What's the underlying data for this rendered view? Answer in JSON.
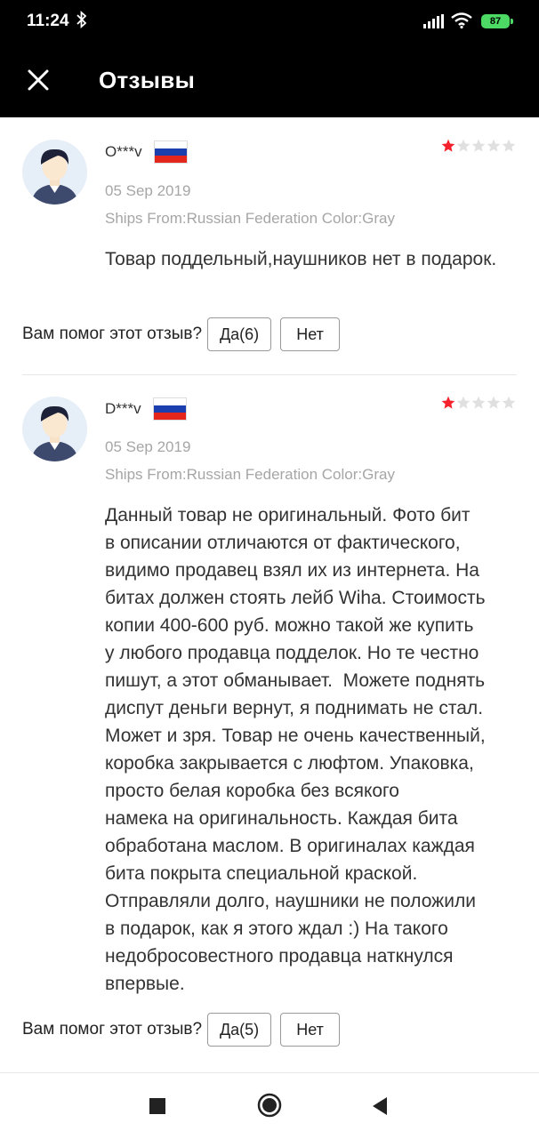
{
  "status_bar": {
    "time": "11:24",
    "battery": "87"
  },
  "header": {
    "title": "Отзывы"
  },
  "colors": {
    "star_active": "#f5222d",
    "star_inactive": "#e0e0e0",
    "muted_text": "#a6a6a6"
  },
  "reviews": [
    {
      "name": "O***v",
      "country": "Russia",
      "rating": 1,
      "max_rating": 5,
      "date": "05 Sep 2019",
      "meta": "Ships From:Russian Federation Color:Gray",
      "text": "Товар поддельный,наушников нет в подарок.",
      "helpful_question": "Вам помог этот отзыв?",
      "yes_label": "Да(6)",
      "no_label": "Нет"
    },
    {
      "name": "D***v",
      "country": "Russia",
      "rating": 1,
      "max_rating": 5,
      "date": "05 Sep 2019",
      "meta": "Ships From:Russian Federation Color:Gray",
      "text": "Данный товар не оригинальный. Фото бит\nв описании отличаются от фактического,\nвидимо продавец взял их из интернета. На\nбитах должен стоять лейб Wiha. Стоимость\nкопии 400-600 руб. можно такой же купить\nу любого продавца подделок. Но те честно\nпишут, а этот обманывает.  Можете поднять\nдиспут деньги вернут, я поднимать не стал.\nМожет и зря. Товар не очень качественный,\nкоробка закрывается с люфтом. Упаковка,\nпросто белая коробка без всякого\nнамека на оригинальность. Каждая бита\nобработана маслом. В оригиналах каждая\nбита покрыта специальной краской.\nОтправляли долго, наушники не положили\nв подарок, как я этого ждал :) На такого\nнедобросовестного продавца наткнулся\nвпервые.",
      "helpful_question": "Вам помог этот отзыв?",
      "yes_label": "Да(5)",
      "no_label": "Нет"
    }
  ]
}
